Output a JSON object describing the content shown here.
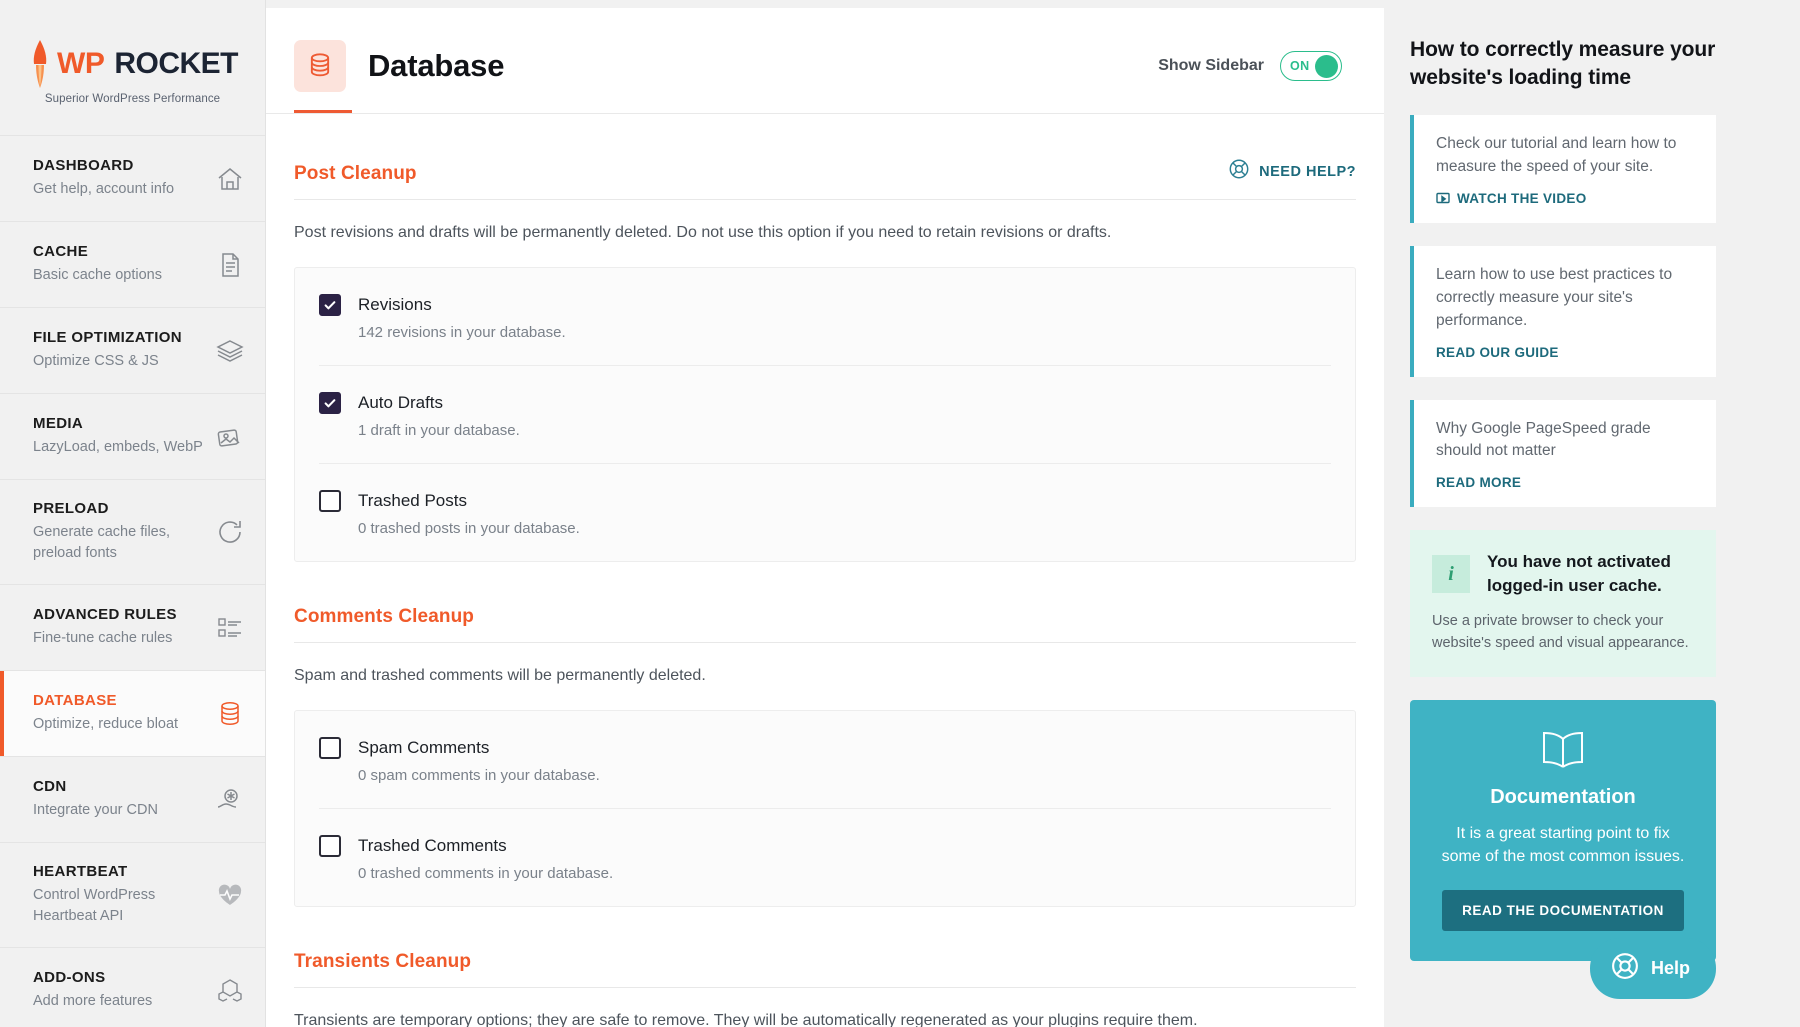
{
  "brand": {
    "name_wp": "WP",
    "name_rocket": "ROCKET",
    "tagline": "Superior WordPress Performance"
  },
  "sidebar": {
    "items": [
      {
        "title": "DASHBOARD",
        "desc": "Get help, account info",
        "icon": "home-icon",
        "active": false
      },
      {
        "title": "CACHE",
        "desc": "Basic cache options",
        "icon": "document-icon",
        "active": false
      },
      {
        "title": "FILE OPTIMIZATION",
        "desc": "Optimize CSS & JS",
        "icon": "layers-icon",
        "active": false
      },
      {
        "title": "MEDIA",
        "desc": "LazyLoad, embeds, WebP",
        "icon": "images-icon",
        "active": false
      },
      {
        "title": "PRELOAD",
        "desc": "Generate cache files, preload fonts",
        "icon": "refresh-icon",
        "active": false
      },
      {
        "title": "ADVANCED RULES",
        "desc": "Fine-tune cache rules",
        "icon": "list-icon",
        "active": false
      },
      {
        "title": "DATABASE",
        "desc": "Optimize, reduce bloat",
        "icon": "database-icon",
        "active": true
      },
      {
        "title": "CDN",
        "desc": "Integrate your CDN",
        "icon": "cloud-icon",
        "active": false
      },
      {
        "title": "HEARTBEAT",
        "desc": "Control WordPress Heartbeat API",
        "icon": "heartbeat-icon",
        "active": false
      },
      {
        "title": "ADD-ONS",
        "desc": "Add more features",
        "icon": "cubes-icon",
        "active": false
      }
    ]
  },
  "header": {
    "title": "Database",
    "icon": "database-icon",
    "sidebar_toggle_label": "Show Sidebar",
    "sidebar_toggle_state": "ON"
  },
  "need_help": {
    "label": "NEED HELP?",
    "icon": "lifebuoy-icon"
  },
  "sections": [
    {
      "title": "Post Cleanup",
      "description": "Post revisions and drafts will be permanently deleted. Do not use this option if you need to retain revisions or drafts.",
      "has_need_help": true,
      "options": [
        {
          "label": "Revisions",
          "sub": "142 revisions in your database.",
          "checked": true
        },
        {
          "label": "Auto Drafts",
          "sub": "1 draft in your database.",
          "checked": true
        },
        {
          "label": "Trashed Posts",
          "sub": "0 trashed posts in your database.",
          "checked": false
        }
      ]
    },
    {
      "title": "Comments Cleanup",
      "description": "Spam and trashed comments will be permanently deleted.",
      "has_need_help": false,
      "options": [
        {
          "label": "Spam Comments",
          "sub": "0 spam comments in your database.",
          "checked": false
        },
        {
          "label": "Trashed Comments",
          "sub": "0 trashed comments in your database.",
          "checked": false
        }
      ]
    },
    {
      "title": "Transients Cleanup",
      "description": "Transients are temporary options; they are safe to remove. They will be automatically regenerated as your plugins require them.",
      "has_need_help": false,
      "options": []
    }
  ],
  "rail": {
    "title": "How to correctly measure your website's loading time",
    "cards": [
      {
        "text": "Check our tutorial and learn how to measure the speed of your site.",
        "link": "WATCH THE VIDEO",
        "link_icon": "video-icon"
      },
      {
        "text": "Learn how to use best practices to correctly measure your site's performance.",
        "link": "READ OUR GUIDE",
        "link_icon": ""
      },
      {
        "text": "Why Google PageSpeed grade should not matter",
        "link": "READ MORE",
        "link_icon": ""
      }
    ],
    "notice": {
      "icon": "info-icon",
      "icon_glyph": "i",
      "title": "You have not activated logged-in user cache.",
      "body": "Use a private browser to check your website's speed and visual appearance."
    },
    "documentation": {
      "icon": "book-icon",
      "title": "Documentation",
      "text": "It is a great starting point to fix some of the most common issues.",
      "button": "READ THE DOCUMENTATION"
    },
    "help_fab": {
      "label": "Help",
      "icon": "lifebuoy-icon"
    }
  },
  "colors": {
    "accent_orange": "#f05a2a",
    "teal": "#3fb3c4",
    "teal_dark": "#1d6f80",
    "green": "#2bbd8c",
    "checkbox_navy": "#2b2245"
  }
}
